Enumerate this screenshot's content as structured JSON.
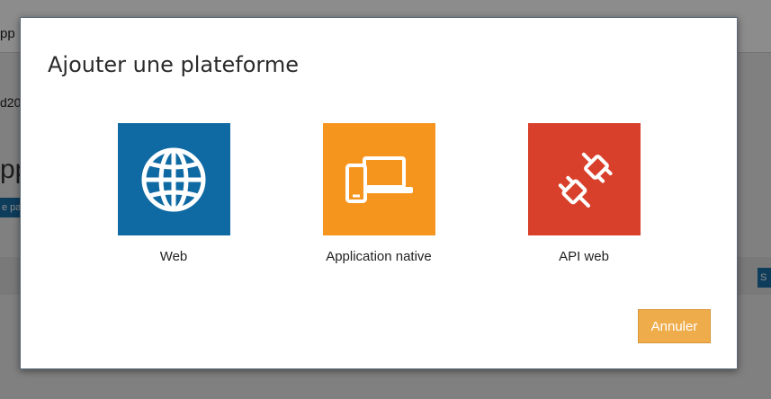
{
  "background": {
    "topbar_text": "pp",
    "id_text": "d20",
    "title": "pp",
    "chip_label": "e pa",
    "right_button_label": "S"
  },
  "dialog": {
    "title": "Ajouter une plateforme",
    "platforms": [
      {
        "label": "Web",
        "icon": "globe-icon",
        "color": "#0f6aa3"
      },
      {
        "label": "Application native",
        "icon": "devices-icon",
        "color": "#f6951e"
      },
      {
        "label": "API web",
        "icon": "plug-icon",
        "color": "#d8402b"
      }
    ],
    "cancel_label": "Annuler",
    "cancel_color": "#efac4b"
  }
}
